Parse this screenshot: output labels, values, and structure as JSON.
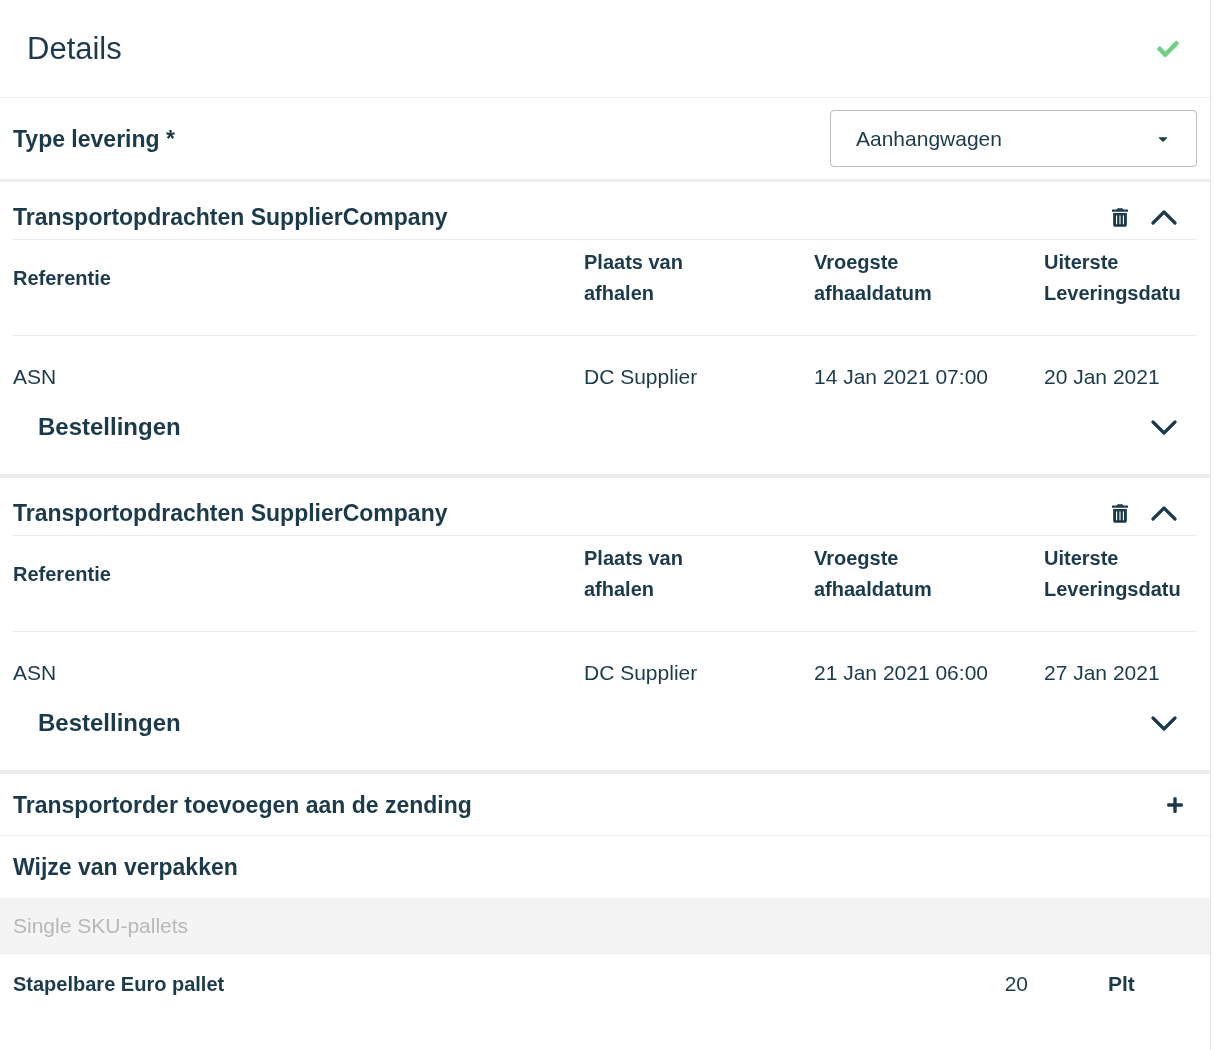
{
  "header": {
    "title": "Details"
  },
  "delivery_type": {
    "label": "Type levering *",
    "value": "Aanhangwagen"
  },
  "transport_orders": [
    {
      "title": "Transportopdrachten SupplierCompany",
      "expanded": true,
      "columns": [
        "Referentie",
        "Plaats van afhalen",
        "Vroegste afhaaldatum",
        "Uiterste Leveringsdatu"
      ],
      "rows": [
        {
          "cells": [
            "ASN",
            "DC Supplier",
            "14 Jan 2021 07:00",
            "20 Jan 2021"
          ],
          "orders_label": "Bestellingen",
          "orders_expanded": false
        }
      ]
    },
    {
      "title": "Transportopdrachten SupplierCompany",
      "expanded": true,
      "columns": [
        "Referentie",
        "Plaats van afhalen",
        "Vroegste afhaaldatum",
        "Uiterste Leveringsdatu"
      ],
      "rows": [
        {
          "cells": [
            "ASN",
            "DC Supplier",
            "21 Jan 2021 06:00",
            "27 Jan 2021"
          ],
          "orders_label": "Bestellingen",
          "orders_expanded": false
        }
      ]
    }
  ],
  "add_transport_order": {
    "label": "Transportorder toevoegen aan de zending"
  },
  "packaging": {
    "title": "Wijze van verpakken",
    "groups": [
      {
        "name": "Single SKU-pallets",
        "items": [
          {
            "name": "Stapelbare Euro pallet",
            "quantity": "20",
            "unit": "Plt"
          }
        ]
      }
    ]
  }
}
